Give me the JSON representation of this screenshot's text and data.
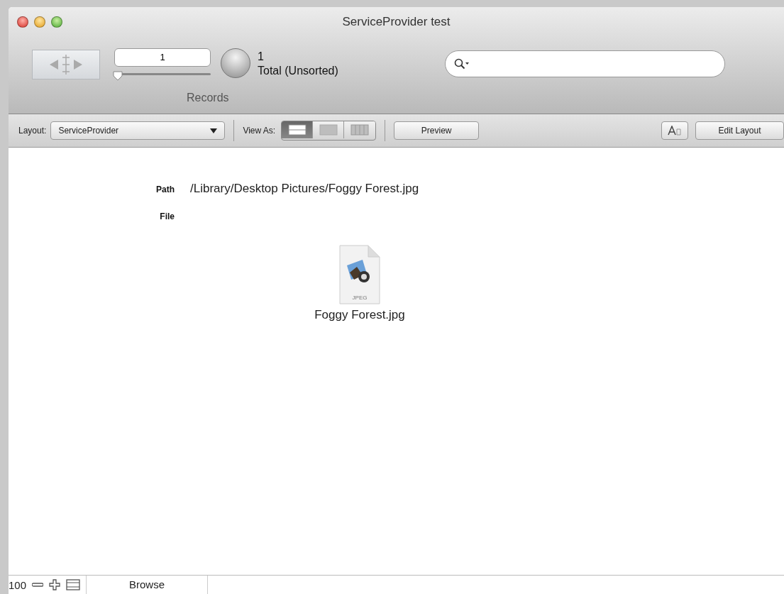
{
  "window": {
    "title": "ServiceProvider test"
  },
  "toolbar": {
    "record_number": "1",
    "slider": {
      "level": 0
    },
    "found_count": "1",
    "total_label": "Total (Unsorted)",
    "records_label": "Records"
  },
  "layout_bar": {
    "layout_label": "Layout:",
    "layout_value": "ServiceProvider",
    "view_as_label": "View As:",
    "view_as": [
      {
        "kind": "form",
        "selected": true
      },
      {
        "kind": "list",
        "selected": false
      },
      {
        "kind": "table",
        "selected": false
      }
    ],
    "preview_button": "Preview",
    "edit_layout_button": "Edit Layout"
  },
  "fields": [
    {
      "label": "Path",
      "value": "/Library/Desktop Pictures/Foggy Forest.jpg"
    },
    {
      "label": "File"
    }
  ],
  "file": {
    "icon_label": "JPEG",
    "name": "Foggy Forest.jpg"
  },
  "status_bar": {
    "zoom": "100",
    "mode": "Browse"
  }
}
